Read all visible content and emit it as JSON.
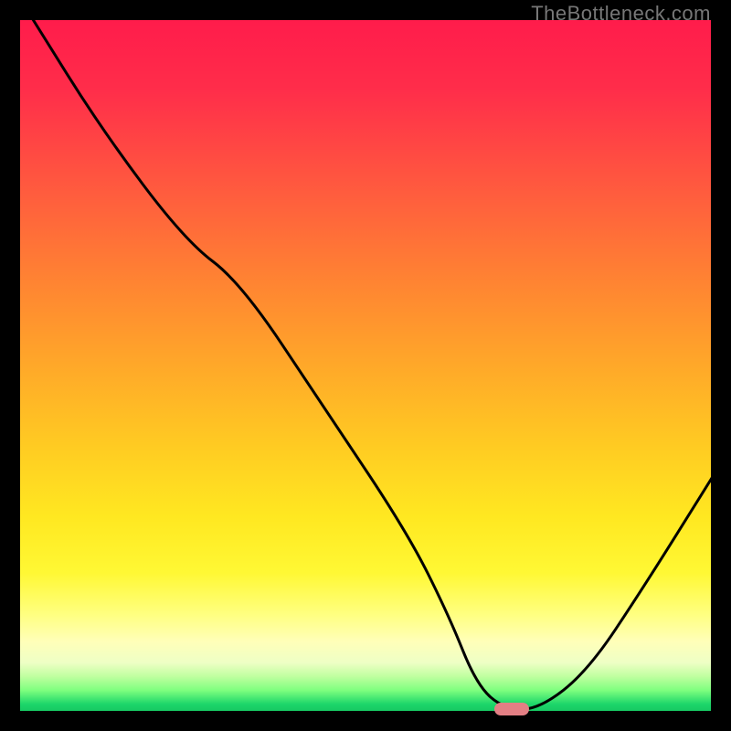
{
  "watermark": "TheBottleneck.com",
  "chart_data": {
    "type": "line",
    "title": "",
    "xlabel": "",
    "ylabel": "",
    "xlim": [
      0,
      100
    ],
    "ylim": [
      0,
      100
    ],
    "grid": false,
    "annotations": [],
    "series": [
      {
        "name": "curve",
        "x": [
          2,
          12,
          24,
          32,
          44,
          56,
          62,
          66,
          70,
          75,
          82,
          90,
          100
        ],
        "values": [
          100,
          84,
          68,
          62,
          44,
          26,
          14,
          4,
          0.5,
          0.5,
          6,
          18,
          34
        ]
      }
    ],
    "marker": {
      "x": 71,
      "y": 0.5,
      "color": "#e37f84"
    }
  }
}
